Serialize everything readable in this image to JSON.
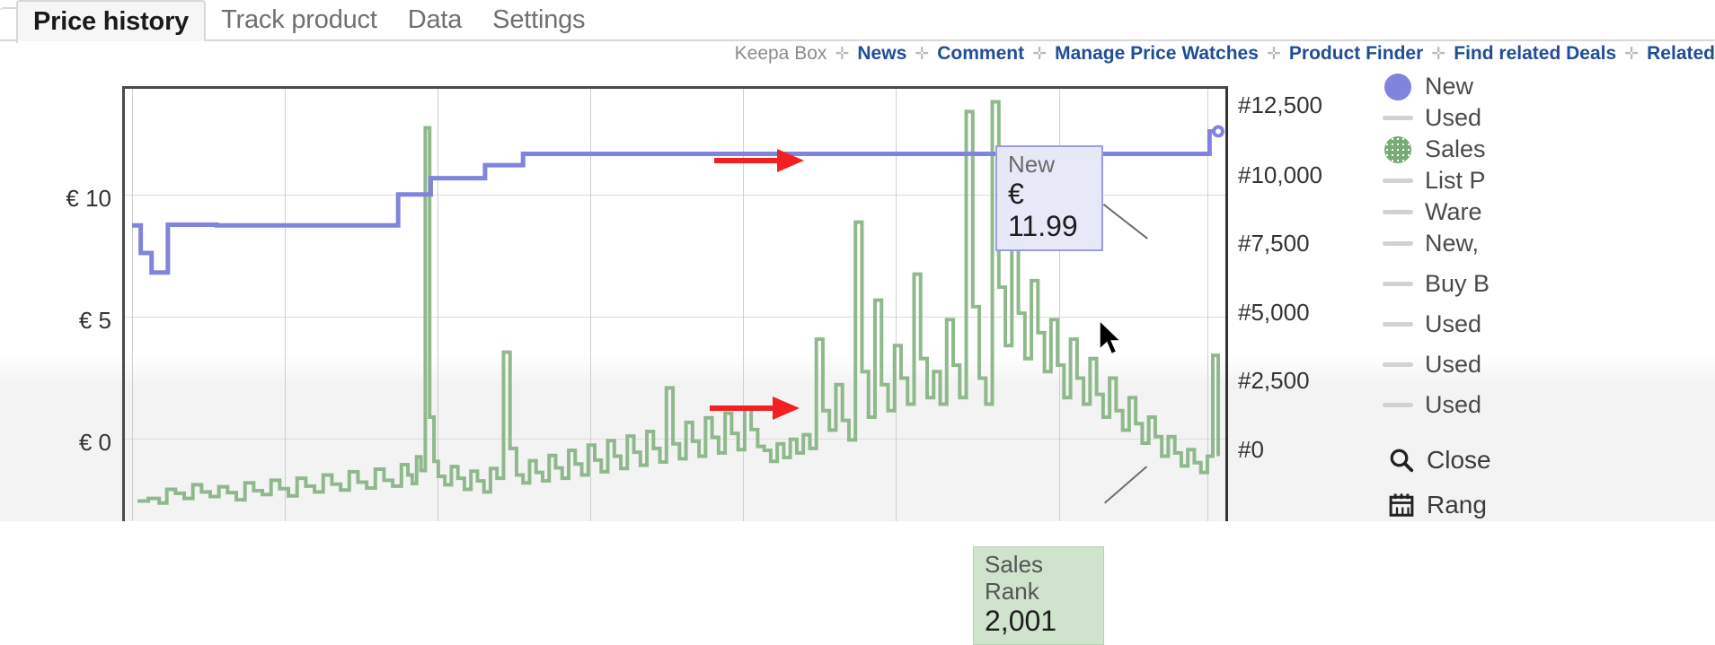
{
  "tabs": [
    {
      "label": "Price history",
      "active": true
    },
    {
      "label": "Track product",
      "active": false
    },
    {
      "label": "Data",
      "active": false
    },
    {
      "label": "Settings",
      "active": false
    }
  ],
  "nav": {
    "label": "Keepa Box",
    "separator": "✛",
    "links": [
      "News",
      "Comment",
      "Manage Price Watches",
      "Product Finder",
      "Find related Deals",
      "Related"
    ]
  },
  "axes": {
    "left": {
      "ticks": [
        "€ 10",
        "€ 5",
        "€ 0"
      ],
      "values": [
        10,
        5,
        0
      ]
    },
    "right": {
      "ticks": [
        "#12,500",
        "#10,000",
        "#7,500",
        "#5,000",
        "#2,500",
        "#0"
      ],
      "values": [
        12500,
        10000,
        7500,
        5000,
        2500,
        0
      ]
    }
  },
  "legend": {
    "items": [
      {
        "label": "New",
        "marker": "dot",
        "color": "#8184dd"
      },
      {
        "label": "Used",
        "marker": "dash",
        "color": "#d2d2d2"
      },
      {
        "label": "Sales",
        "marker": "dot-pattern",
        "color": "#7aab77"
      },
      {
        "label": "List P",
        "marker": "dash",
        "color": "#d2d2d2"
      },
      {
        "label": "Ware",
        "marker": "dash",
        "color": "#d2d2d2"
      },
      {
        "label": "New,",
        "marker": "dash",
        "color": "#d2d2d2"
      },
      {
        "label": "Buy B",
        "marker": "dash",
        "color": "#d2d2d2"
      },
      {
        "label": "Used",
        "marker": "dash",
        "color": "#d2d2d2"
      },
      {
        "label": "Used",
        "marker": "dash",
        "color": "#d2d2d2"
      },
      {
        "label": "Used",
        "marker": "dash",
        "color": "#d2d2d2"
      }
    ],
    "tools": [
      {
        "label": "Close",
        "icon": "search-icon"
      },
      {
        "label": "Rang",
        "icon": "calendar-icon"
      }
    ]
  },
  "tooltips": {
    "new": {
      "title": "New",
      "value": "€ 11.99"
    },
    "rank": {
      "title": "Sales Rank",
      "value": "2,001"
    }
  },
  "colors": {
    "new_line": "#8184dd",
    "sales_rank_line": "#8fb98c",
    "arrow": "#f22020",
    "link": "#1f4e96",
    "tooltip_new_bg": "#e7e9f8",
    "tooltip_rank_bg": "#cfe3cd"
  },
  "chart_data": {
    "type": "line",
    "title": "Price history",
    "xlabel": "",
    "ylabel": "€",
    "y2label": "Sales Rank",
    "ylim": [
      0,
      13.3
    ],
    "y2lim": [
      0,
      13300
    ],
    "grid": true,
    "legend_position": "right",
    "series": [
      {
        "name": "New",
        "color": "#8184dd",
        "axis": "left",
        "step": true,
        "points": [
          [
            0.0,
            9.1
          ],
          [
            0.8,
            9.1
          ],
          [
            0.8,
            8.25
          ],
          [
            1.8,
            8.25
          ],
          [
            1.8,
            7.65
          ],
          [
            3.3,
            7.65
          ],
          [
            3.3,
            9.12
          ],
          [
            7.8,
            9.12
          ],
          [
            7.8,
            9.1
          ],
          [
            24.5,
            9.1
          ],
          [
            24.5,
            10.05
          ],
          [
            27.5,
            10.05
          ],
          [
            27.5,
            10.55
          ],
          [
            32.5,
            10.55
          ],
          [
            32.5,
            10.95
          ],
          [
            36.0,
            10.95
          ],
          [
            36.0,
            11.3
          ],
          [
            99.2,
            11.3
          ],
          [
            99.2,
            11.99
          ],
          [
            100.0,
            11.99
          ]
        ]
      },
      {
        "name": "Sales Rank",
        "color": "#8fb98c",
        "axis": "right",
        "step": true,
        "points": [
          [
            0.5,
            620
          ],
          [
            1.5,
            700
          ],
          [
            2.5,
            560
          ],
          [
            3.2,
            980
          ],
          [
            4.0,
            860
          ],
          [
            4.8,
            700
          ],
          [
            5.6,
            1120
          ],
          [
            6.4,
            900
          ],
          [
            7.2,
            760
          ],
          [
            8.0,
            1060
          ],
          [
            8.8,
            880
          ],
          [
            9.6,
            660
          ],
          [
            10.4,
            1180
          ],
          [
            11.2,
            940
          ],
          [
            12.0,
            820
          ],
          [
            12.8,
            1260
          ],
          [
            13.6,
            1000
          ],
          [
            14.4,
            780
          ],
          [
            15.2,
            1320
          ],
          [
            16.0,
            1080
          ],
          [
            16.8,
            900
          ],
          [
            17.6,
            1420
          ],
          [
            18.4,
            1140
          ],
          [
            19.2,
            960
          ],
          [
            20.0,
            1520
          ],
          [
            20.8,
            1200
          ],
          [
            21.6,
            1020
          ],
          [
            22.4,
            1600
          ],
          [
            23.2,
            1260
          ],
          [
            24.0,
            1080
          ],
          [
            24.8,
            1740
          ],
          [
            25.4,
            1420
          ],
          [
            25.8,
            1160
          ],
          [
            26.2,
            1980
          ],
          [
            26.6,
            1560
          ],
          [
            27.0,
            12100
          ],
          [
            27.4,
            3200
          ],
          [
            27.8,
            1840
          ],
          [
            28.2,
            1380
          ],
          [
            28.8,
            1120
          ],
          [
            29.4,
            1680
          ],
          [
            30.0,
            1320
          ],
          [
            30.6,
            980
          ],
          [
            31.2,
            1540
          ],
          [
            31.8,
            1240
          ],
          [
            32.4,
            900
          ],
          [
            33.0,
            1620
          ],
          [
            33.6,
            1320
          ],
          [
            34.2,
            5200
          ],
          [
            34.8,
            2240
          ],
          [
            35.4,
            1420
          ],
          [
            36.0,
            1180
          ],
          [
            36.6,
            1860
          ],
          [
            37.2,
            1500
          ],
          [
            37.8,
            1240
          ],
          [
            38.4,
            2020
          ],
          [
            39.0,
            1640
          ],
          [
            39.6,
            1320
          ],
          [
            40.2,
            2180
          ],
          [
            40.8,
            1760
          ],
          [
            41.4,
            1420
          ],
          [
            42.0,
            2340
          ],
          [
            42.6,
            1880
          ],
          [
            43.2,
            1520
          ],
          [
            43.8,
            2480
          ],
          [
            44.4,
            2000
          ],
          [
            45.0,
            1620
          ],
          [
            45.6,
            2620
          ],
          [
            46.2,
            2120
          ],
          [
            46.8,
            1720
          ],
          [
            47.4,
            2760
          ],
          [
            48.0,
            2240
          ],
          [
            48.6,
            1820
          ],
          [
            49.2,
            4100
          ],
          [
            49.8,
            2380
          ],
          [
            50.4,
            1920
          ],
          [
            51.0,
            3040
          ],
          [
            51.6,
            2460
          ],
          [
            52.2,
            2000
          ],
          [
            52.8,
            3180
          ],
          [
            53.4,
            2580
          ],
          [
            54.0,
            2100
          ],
          [
            54.6,
            3320
          ],
          [
            55.2,
            2700
          ],
          [
            55.8,
            2200
          ],
          [
            56.4,
            3460
          ],
          [
            57.0,
            2820
          ],
          [
            57.6,
            2300
          ],
          [
            58.2,
            2180
          ],
          [
            58.8,
            1840
          ],
          [
            59.4,
            2380
          ],
          [
            60.0,
            1960
          ],
          [
            60.6,
            2520
          ],
          [
            61.2,
            2100
          ],
          [
            61.8,
            2660
          ],
          [
            62.4,
            2240
          ],
          [
            63.0,
            5600
          ],
          [
            63.6,
            3400
          ],
          [
            64.2,
            2800
          ],
          [
            64.8,
            4200
          ],
          [
            65.4,
            3100
          ],
          [
            66.0,
            2500
          ],
          [
            66.6,
            9200
          ],
          [
            67.2,
            4600
          ],
          [
            67.8,
            3200
          ],
          [
            68.4,
            6800
          ],
          [
            69.0,
            4200
          ],
          [
            69.6,
            3400
          ],
          [
            70.2,
            5400
          ],
          [
            70.8,
            4400
          ],
          [
            71.4,
            3600
          ],
          [
            72.0,
            7600
          ],
          [
            72.6,
            5000
          ],
          [
            73.2,
            3800
          ],
          [
            73.8,
            4600
          ],
          [
            74.4,
            3600
          ],
          [
            75.0,
            6200
          ],
          [
            75.6,
            4800
          ],
          [
            76.2,
            3800
          ],
          [
            76.8,
            12600
          ],
          [
            77.4,
            6600
          ],
          [
            78.0,
            4400
          ],
          [
            78.6,
            3600
          ],
          [
            79.2,
            12900
          ],
          [
            79.8,
            7200
          ],
          [
            80.4,
            5400
          ],
          [
            81.0,
            8600
          ],
          [
            81.6,
            6400
          ],
          [
            82.2,
            5000
          ],
          [
            82.8,
            7400
          ],
          [
            83.4,
            5800
          ],
          [
            84.0,
            4600
          ],
          [
            84.6,
            6200
          ],
          [
            85.2,
            4800
          ],
          [
            85.8,
            3800
          ],
          [
            86.4,
            5600
          ],
          [
            87.0,
            4400
          ],
          [
            87.6,
            3600
          ],
          [
            88.2,
            5000
          ],
          [
            88.8,
            3900
          ],
          [
            89.4,
            3200
          ],
          [
            90.0,
            4400
          ],
          [
            90.6,
            3400
          ],
          [
            91.2,
            2800
          ],
          [
            91.8,
            3800
          ],
          [
            92.4,
            3000
          ],
          [
            93.0,
            2400
          ],
          [
            93.6,
            3200
          ],
          [
            94.2,
            2600
          ],
          [
            94.8,
            2000
          ],
          [
            95.4,
            2600
          ],
          [
            96.0,
            2100
          ],
          [
            96.6,
            1700
          ],
          [
            97.2,
            2200
          ],
          [
            97.8,
            1800
          ],
          [
            98.4,
            1500
          ],
          [
            99.0,
            2001
          ],
          [
            99.5,
            5100
          ],
          [
            100.0,
            2001
          ]
        ]
      }
    ],
    "annotations": [
      {
        "text": "New € 11.99",
        "type": "tooltip",
        "series": "New",
        "value": 11.99
      },
      {
        "text": "Sales Rank 2,001",
        "type": "tooltip",
        "series": "Sales Rank",
        "value": 2001
      },
      {
        "type": "arrow",
        "color": "#f22020",
        "points_to": "new-tooltip"
      },
      {
        "type": "arrow",
        "color": "#f22020",
        "points_to": "rank-tooltip"
      }
    ]
  }
}
